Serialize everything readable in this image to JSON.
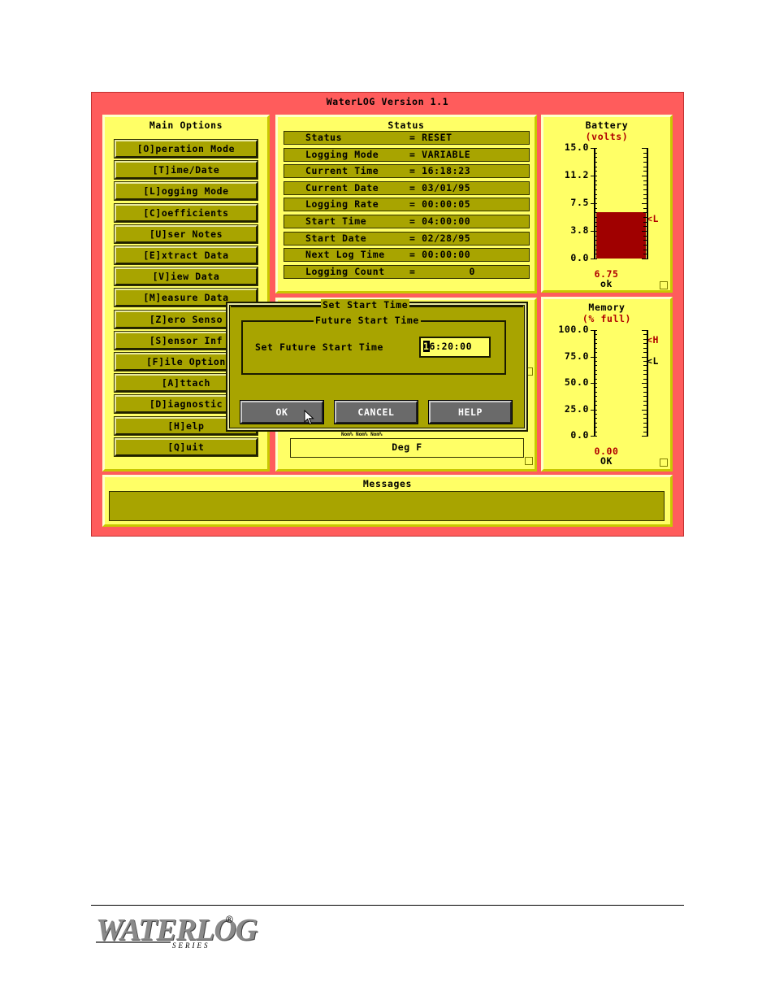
{
  "window": {
    "title": "WaterLOG Version 1.1"
  },
  "main_options": {
    "title": "Main Options",
    "items": [
      "[O]peration Mode",
      "[T]ime/Date",
      "[L]ogging Mode",
      "[C]oefficients",
      "[U]ser Notes",
      "[E]xtract Data",
      "[V]iew Data",
      "[M]easure Data",
      "[Z]ero Senso",
      "[S]ensor Inf",
      "[F]ile Option",
      "[A]ttach",
      "[D]iagnostic",
      "[H]elp",
      "[Q]uit"
    ]
  },
  "status": {
    "title": "Status",
    "rows": [
      {
        "label": "Status",
        "value": "RESET"
      },
      {
        "label": "Logging Mode",
        "value": "VARIABLE"
      },
      {
        "label": "Current Time",
        "value": "16:18:23"
      },
      {
        "label": "Current Date",
        "value": "03/01/95"
      },
      {
        "label": "Logging Rate",
        "value": "00:00:05"
      },
      {
        "label": "Start Time",
        "value": "04:00:00"
      },
      {
        "label": "Start Date",
        "value": "02/28/95"
      },
      {
        "label": "Next Log Time",
        "value": "00:00:00"
      },
      {
        "label": "Logging Count",
        "value": "0"
      }
    ]
  },
  "battery": {
    "title": "Battery",
    "subtitle": "(volts)",
    "ticks": [
      "15.0",
      "11.2",
      "7.5",
      "3.8",
      "0.0"
    ],
    "reading": "6.75",
    "state": "ok",
    "marker": "L",
    "fill_fraction": 0.42,
    "fill_color": "#a00000"
  },
  "memory": {
    "title": "Memory",
    "subtitle": "(% full)",
    "ticks": [
      "100.0",
      "75.0",
      "50.0",
      "25.0",
      "0.0"
    ],
    "reading": "0.00",
    "state": "OK",
    "marker_h": "H",
    "marker_l": "L"
  },
  "sensor_panel": {
    "units": "Deg F",
    "tiny_labels": "Nom% Nom% Nom%"
  },
  "messages": {
    "title": "Messages",
    "text": ""
  },
  "dialog": {
    "title": "Set Start Time",
    "group_title": "Future Start Time",
    "field_label": "Set Future Start Time",
    "field_value": "16:20:00",
    "ok": "OK",
    "cancel": "CANCEL",
    "help": "HELP"
  },
  "footer": {
    "logo_main": "WATERLOG",
    "logo_sub": "SERIES",
    "registered": "®"
  },
  "colors": {
    "window_bg": "#ff5c5c",
    "panel_bg": "#ffff66",
    "control_bg": "#a8a400",
    "accent_red": "#b00000"
  }
}
